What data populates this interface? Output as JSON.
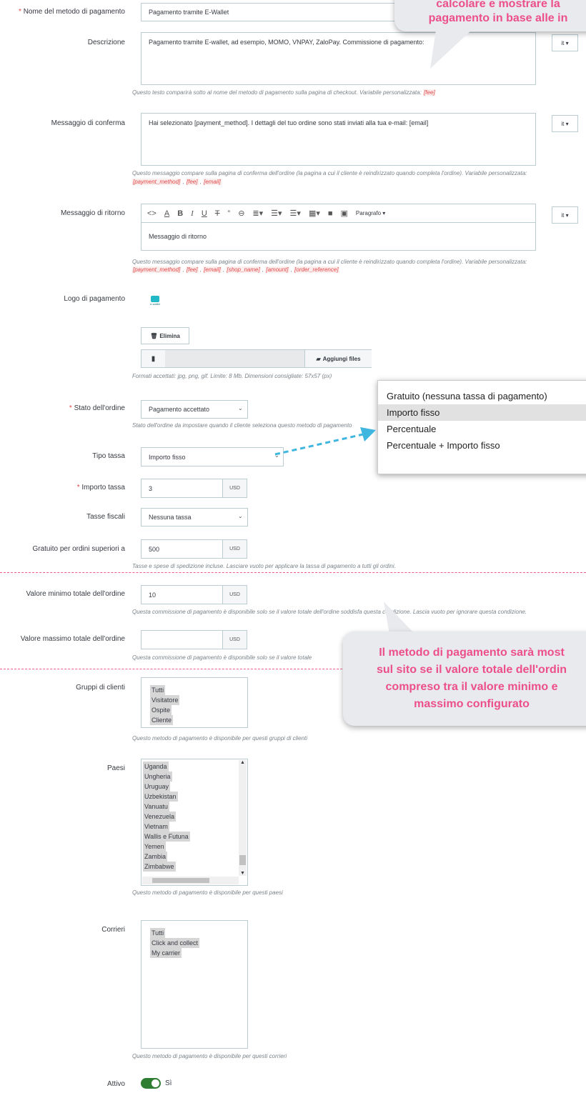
{
  "fields": {
    "name": {
      "label": "Nome del metodo di pagamento",
      "value": "Pagamento tramite E-Wallet"
    },
    "description": {
      "label": "Descrizione",
      "value": "Pagamento tramite E-wallet, ad esempio, MOMO, VNPAY, ZaloPay. Commissione di pagamento:",
      "lang": "it ▾",
      "help": "Questo testo comparirà sotto al nome del metodo di pagamento sulla pagina di checkout. Variabile personalizzata:",
      "help_var": "[fee]"
    },
    "confirmation": {
      "label": "Messaggio di conferma",
      "value": "Hai selezionato [payment_method]. I dettagli del tuo ordine sono stati inviati alla tua e-mail: [email]",
      "lang": "it ▾",
      "help": "Questo messaggio compare sulla pagina di conferma dell'ordine (la pagina a cui il cliente è reindirizzato quando completa l'ordine). Variabile personalizzata:",
      "vars": [
        "[payment_method]",
        "[fee]",
        "[email]"
      ]
    },
    "return": {
      "label": "Messaggio di ritorno",
      "value": "Messaggio di ritorno",
      "lang": "it ▾",
      "paragraph": "Paragrafo ▾",
      "help": "Questo messaggio compare sulla pagina di conferma dell'ordine (la pagina a cui il cliente è reindirizzato quando completa l'ordine). Variabile personalizzata:",
      "vars": [
        "[payment_method]",
        "[fee]",
        "[email]",
        "[shop_name]",
        "[amount]",
        "[order_reference]"
      ]
    },
    "logo": {
      "label": "Logo di pagamento",
      "logo_text": "e-wallet",
      "delete": "Elimina",
      "add_files": "Aggiungi files",
      "help": "Formati accettati: jpg, png, gif. Limite: 8 Mb. Dimensioni consigliate: 57x57 (px)"
    },
    "order_state": {
      "label": "Stato dell'ordine",
      "value": "Pagamento accettato",
      "help": "Stato dell'ordine da impostare quando il cliente seleziona questo metodo di pagamento"
    },
    "fee_type": {
      "label": "Tipo tassa",
      "value": "Importo fisso"
    },
    "fee_amount": {
      "label": "Importo tassa",
      "value": "3",
      "unit": "USD"
    },
    "tax": {
      "label": "Tasse fiscali",
      "value": "Nessuna tassa"
    },
    "free_over": {
      "label": "Gratuito per ordini superiori a",
      "value": "500",
      "unit": "USD",
      "help": "Tasse e spese di spedizione incluse. Lasciare vuoto per applicare la tassa di pagamento a tutti gli ordini."
    },
    "min_total": {
      "label": "Valore minimo totale dell'ordine",
      "value": "10",
      "unit": "USD",
      "help": "Questa commissione di pagamento è disponibile solo se il valore totale dell'ordine soddisfa questa condizione. Lascia vuoto per ignorare questa condizione."
    },
    "max_total": {
      "label": "Valore massimo totale dell'ordine",
      "value": "",
      "unit": "USD",
      "help": "Questa commissione di pagamento è disponibile solo se il valore totale"
    },
    "groups": {
      "label": "Gruppi di clienti",
      "items": [
        "Tutti",
        "Visitatore",
        "Ospite",
        "Cliente"
      ],
      "help": "Questo metodo di pagamento è disponibile per questi gruppi di clienti"
    },
    "countries": {
      "label": "Paesi",
      "items": [
        "Uganda",
        "Ungheria",
        "Uruguay",
        "Uzbekistan",
        "Vanuatu",
        "Venezuela",
        "Vietnam",
        "Wallis e Futuna",
        "Yemen",
        "Zambia",
        "Zimbabwe"
      ],
      "help": "Questo metodo di pagamento è disponibile per questi paesi"
    },
    "carriers": {
      "label": "Corrieri",
      "items": [
        "Tutti",
        "Click and collect",
        "My carrier"
      ],
      "help": "Questo metodo di pagamento è disponibile per questi corrieri"
    },
    "active": {
      "label": "Attivo",
      "value": "Sì"
    }
  },
  "fee_dropdown": {
    "options": [
      "Gratuito (nessuna tassa di pagamento)",
      "Importo fisso",
      "Percentuale",
      "Percentuale + Importo fisso"
    ],
    "selected": "Importo fisso"
  },
  "callout_top": {
    "line1": "calcolare e mostrare la",
    "line2": "pagamento in base alle in"
  },
  "callout_bottom": {
    "lines": [
      "Il metodo di pagamento sarà most",
      "sul sito se il valore totale dell'ordin",
      "compreso tra il valore minimo e",
      "massimo configurato"
    ]
  },
  "colors": {
    "accent_pink": "#ec4f8b",
    "arrow_blue": "#3fb6e0",
    "toggle_green": "#2e7d32"
  }
}
